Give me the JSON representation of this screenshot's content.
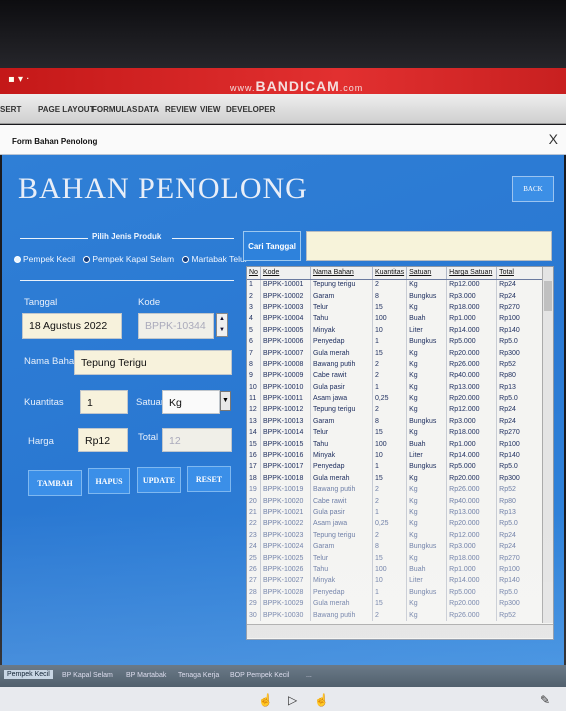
{
  "recorder": {
    "brand": "BANDICAM",
    "www": "www.",
    "tld": ".com"
  },
  "ribbon": {
    "tabs": [
      "SERT",
      "PAGE LAYOUT",
      "FORMULAS",
      "DATA",
      "REVIEW",
      "VIEW",
      "DEVELOPER"
    ]
  },
  "window": {
    "title": "Form Bahan Penolong",
    "close": "X"
  },
  "header": {
    "title": "BAHAN PENOLONG",
    "back_label": "BACK"
  },
  "produk": {
    "label": "Pilih Jenis Produk",
    "options": [
      "Pempek Kecil",
      "Pempek Kapal Selam",
      "Martabak Telur"
    ],
    "selected": "Pempek Kecil"
  },
  "form": {
    "tanggal_label": "Tanggal",
    "tanggal_value": "18 Agustus 2022",
    "kode_label": "Kode",
    "kode_value": "BPPK-10344",
    "nama_label": "Nama Bahan",
    "nama_value": "Tepung Terigu",
    "kuantitas_label": "Kuantitas",
    "kuantitas_value": "1",
    "satuan_label": "Satuan",
    "satuan_value": "Kg",
    "harga_label": "Harga",
    "harga_value": "Rp12",
    "total_label": "Total",
    "total_value": "12"
  },
  "buttons": {
    "tambah": "TAMBAH",
    "hapus": "HAPUS",
    "update": "UPDATE",
    "reset": "RESET"
  },
  "search": {
    "label": "Cari Tanggal",
    "value": ""
  },
  "table": {
    "columns": [
      "No",
      "Kode",
      "Nama Bahan",
      "Kuantitas",
      "Satuan",
      "Harga Satuan",
      "Total"
    ],
    "rows": [
      [
        "1",
        "BPPK-10001",
        "Tepung terigu",
        "2",
        "Kg",
        "Rp12.000",
        "Rp24"
      ],
      [
        "2",
        "BPPK-10002",
        "Garam",
        "8",
        "Bungkus",
        "Rp3.000",
        "Rp24"
      ],
      [
        "3",
        "BPPK-10003",
        "Telur",
        "15",
        "Kg",
        "Rp18.000",
        "Rp270"
      ],
      [
        "4",
        "BPPK-10004",
        "Tahu",
        "100",
        "Buah",
        "Rp1.000",
        "Rp100"
      ],
      [
        "5",
        "BPPK-10005",
        "Minyak",
        "10",
        "Liter",
        "Rp14.000",
        "Rp140"
      ],
      [
        "6",
        "BPPK-10006",
        "Penyedap",
        "1",
        "Bungkus",
        "Rp5.000",
        "Rp5.0"
      ],
      [
        "7",
        "BPPK-10007",
        "Gula merah",
        "15",
        "Kg",
        "Rp20.000",
        "Rp300"
      ],
      [
        "8",
        "BPPK-10008",
        "Bawang putih",
        "2",
        "Kg",
        "Rp26.000",
        "Rp52"
      ],
      [
        "9",
        "BPPK-10009",
        "Cabe rawit",
        "2",
        "Kg",
        "Rp40.000",
        "Rp80"
      ],
      [
        "10",
        "BPPK-10010",
        "Gula pasir",
        "1",
        "Kg",
        "Rp13.000",
        "Rp13"
      ],
      [
        "11",
        "BPPK-10011",
        "Asam jawa",
        "0,25",
        "Kg",
        "Rp20.000",
        "Rp5.0"
      ],
      [
        "12",
        "BPPK-10012",
        "Tepung terigu",
        "2",
        "Kg",
        "Rp12.000",
        "Rp24"
      ],
      [
        "13",
        "BPPK-10013",
        "Garam",
        "8",
        "Bungkus",
        "Rp3.000",
        "Rp24"
      ],
      [
        "14",
        "BPPK-10014",
        "Telur",
        "15",
        "Kg",
        "Rp18.000",
        "Rp270"
      ],
      [
        "15",
        "BPPK-10015",
        "Tahu",
        "100",
        "Buah",
        "Rp1.000",
        "Rp100"
      ],
      [
        "16",
        "BPPK-10016",
        "Minyak",
        "10",
        "Liter",
        "Rp14.000",
        "Rp140"
      ],
      [
        "17",
        "BPPK-10017",
        "Penyedap",
        "1",
        "Bungkus",
        "Rp5.000",
        "Rp5.0"
      ],
      [
        "18",
        "BPPK-10018",
        "Gula merah",
        "15",
        "Kg",
        "Rp20.000",
        "Rp300"
      ],
      [
        "19",
        "BPPK-10019",
        "Bawang putih",
        "2",
        "Kg",
        "Rp26.000",
        "Rp52"
      ],
      [
        "20",
        "BPPK-10020",
        "Cabe rawit",
        "2",
        "Kg",
        "Rp40.000",
        "Rp80"
      ],
      [
        "21",
        "BPPK-10021",
        "Gula pasir",
        "1",
        "Kg",
        "Rp13.000",
        "Rp13"
      ],
      [
        "22",
        "BPPK-10022",
        "Asam jawa",
        "0,25",
        "Kg",
        "Rp20.000",
        "Rp5.0"
      ],
      [
        "23",
        "BPPK-10023",
        "Tepung terigu",
        "2",
        "Kg",
        "Rp12.000",
        "Rp24"
      ],
      [
        "24",
        "BPPK-10024",
        "Garam",
        "8",
        "Bungkus",
        "Rp3.000",
        "Rp24"
      ],
      [
        "25",
        "BPPK-10025",
        "Telur",
        "15",
        "Kg",
        "Rp18.000",
        "Rp270"
      ],
      [
        "26",
        "BPPK-10026",
        "Tahu",
        "100",
        "Buah",
        "Rp1.000",
        "Rp100"
      ],
      [
        "27",
        "BPPK-10027",
        "Minyak",
        "10",
        "Liter",
        "Rp14.000",
        "Rp140"
      ],
      [
        "28",
        "BPPK-10028",
        "Penyedap",
        "1",
        "Bungkus",
        "Rp5.000",
        "Rp5.0"
      ],
      [
        "29",
        "BPPK-10029",
        "Gula merah",
        "15",
        "Kg",
        "Rp20.000",
        "Rp300"
      ],
      [
        "30",
        "BPPK-10030",
        "Bawang putih",
        "2",
        "Kg",
        "Rp26.000",
        "Rp52"
      ]
    ]
  },
  "sheet_tabs": [
    "Pempek Kecil",
    "BP Kapal Selam",
    "BP Martabak",
    "Tenaga Kerja",
    "BOP Pempek Kecil",
    "..."
  ],
  "active_sheet": "Pempek Kecil",
  "colors": {
    "form_bg": "#2f7fd6",
    "title_bar": "#c41818",
    "field_bg": "#f7f2dc"
  }
}
